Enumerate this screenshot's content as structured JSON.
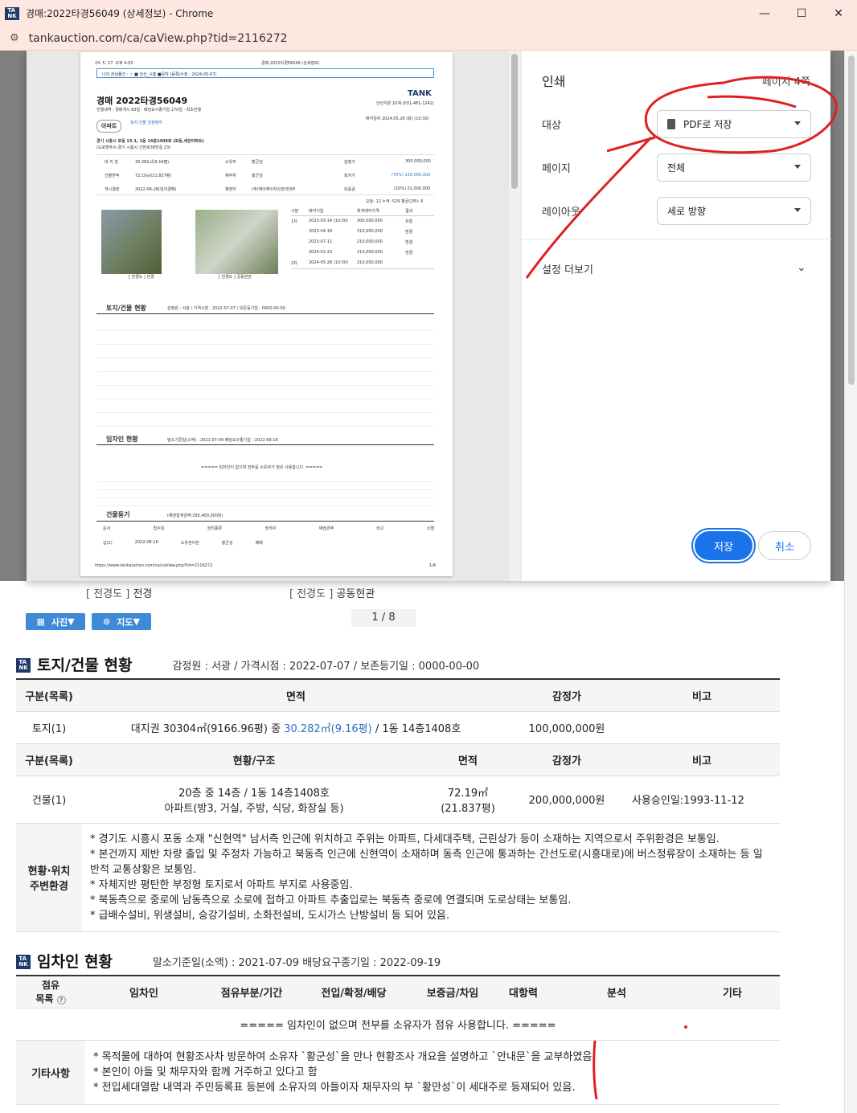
{
  "window": {
    "title": "경매:2022타경56049 (상세정보) - Chrome",
    "url": "tankauction.com/ca/caView.php?tid=2116272",
    "minimize": "—",
    "maximize": "☐",
    "close": "✕"
  },
  "print_dialog": {
    "heading": "인쇄",
    "page_count": "페이지 4쪽",
    "destination_label": "대상",
    "destination_value": "PDF로 저장",
    "pages_label": "페이지",
    "pages_value": "전체",
    "layout_label": "레이아웃",
    "layout_value": "세로 방향",
    "more_settings": "설정 더보기",
    "save": "저장",
    "cancel": "취소"
  },
  "preview": {
    "datetime": "24. 5. 27. 오후 4:03",
    "doc_title": "경매:2022타경56049 (상세정보)",
    "interest_bar": "나의 관심물건 : ☆ ■ 안산_시흥 ■문자 (등록/수정 : 2024-05-07)",
    "tank": "TANK",
    "court": "안산지원 10계 (031-481-1242)",
    "case_no": "경매 2022타경56049",
    "progress": "진행내역 : 경매개시 83일 · 배당요구종기일 170일 · 최초진행",
    "sale_date": "매각일자 2024.05.28 (화) (10:30)",
    "type_badge": "아파트",
    "land_link": "토지·건물 일괄매각",
    "address": "경기 시흥시 포동 13-1, 1동 14층1408호 (포동,세안아파트)",
    "road_address": "(도로명주소:경기 시흥시 신현로38번길 23)",
    "f_area_l": "대 지 권",
    "f_area_v": "30.282㎡(9.16평)",
    "f_owner_l": "소유자",
    "f_owner_v": "황군성",
    "f_appr_l": "감정가",
    "f_appr_v": "300,000,000",
    "f_bld_l": "건물면적",
    "f_bld_v": "72.19㎡(21.837평)",
    "f_debtor_l": "채무자",
    "f_debtor_v": "황군성",
    "f_min_l": "최저가",
    "f_min_v": "(70%) 210,000,000",
    "f_start_l": "개시결정",
    "f_start_v": "2022-06-28(임의경매)",
    "f_cred_l": "채권자",
    "f_cred_v": "(주)케이케이자산관리대부",
    "f_dep_l": "보증금",
    "f_dep_v": "(10%) 21,000,000",
    "views": "오늘: 12 누적: 529 평균(2주): 6",
    "hist_headers": [
      "구분",
      "매각기일",
      "최저매각가격",
      "결과"
    ],
    "hist_rows": [
      [
        "1차",
        "2023-03-14 (10:30)",
        "300,000,000",
        "유찰"
      ],
      [
        "",
        "2023-04-18",
        "210,000,000",
        "변경"
      ],
      [
        "",
        "2023-07-11",
        "210,000,000",
        "변경"
      ],
      [
        "",
        "2024-01-23",
        "210,000,000",
        "변경"
      ],
      [
        "2차",
        "2024-05-28 (10:30)",
        "210,000,000",
        ""
      ]
    ],
    "photo1": "[ 전경도 ] 전경",
    "photo2": "[ 전경도 ] 공동현관",
    "land_title": "토지/건물 현황",
    "land_meta": "감정원 : 서광 / 가격시점 : 2022-07-07 / 보존등기일 : 0000-00-00",
    "tenant_title": "임차인 현황",
    "tenant_meta": "말소기준일(소액) : 2021-07-09 배당요구종기일 : 2022-09-19",
    "tenant_none": "===== 임차인이 없으며 전부를 소유자가 점유 사용합니다. =====",
    "reg_title": "건물등기",
    "reg_meta": "(채권합계금액:295,400,000원)",
    "reg_headers": [
      "순서",
      "접수일",
      "권리종류",
      "권리자",
      "채권금액",
      "비고",
      "소멸"
    ],
    "reg_row": [
      "갑(2)",
      "2022-08-16",
      "소유권이전",
      "황군성",
      "",
      "매매",
      ""
    ],
    "footer_url": "https://www.tankauction.com/ca/caView.php?tid=2116272",
    "footer_page": "1/4"
  },
  "page": {
    "caption1_a": "[ 전경도 ]",
    "caption1_b": "전경",
    "caption2_a": "[ 전경도 ]",
    "caption2_b": "공동현관",
    "photo_btn": "사진",
    "map_btn": "지도",
    "pager": "1 / 8",
    "land": {
      "title": "토지/건물 현황",
      "meta": "감정원 : 서광 / 가격시점 : 2022-07-07 / 보존등기일 : 0000-00-00",
      "h1": [
        "구분(목록)",
        "면적",
        "감정가",
        "비고"
      ],
      "land_label": "토지(1)",
      "land_area_a": "대지권 30304㎡(9166.96평) 중 ",
      "land_area_b": "30.282㎡(9.16평)",
      "land_area_c": " / 1동 14층1408호",
      "land_price": "100,000,000원",
      "h2": [
        "구분(목록)",
        "현황/구조",
        "면적",
        "감정가",
        "비고"
      ],
      "bld_label": "건물(1)",
      "bld_struct_1": "20층 중 14층 / 1동 14층1408호",
      "bld_struct_2": "아파트(방3, 거실, 주방, 식당, 화장실 등)",
      "bld_area_1": "72.19㎡",
      "bld_area_2": "(21.837평)",
      "bld_price": "200,000,000원",
      "bld_note": "사용승인일:1993-11-12",
      "env_label_1": "현황·위치",
      "env_label_2": "주변환경",
      "env": [
        "* 경기도 시흥시 포동 소재 \"신현역\" 남서측 인근에 위치하고 주위는 아파트, 다세대주택, 근린상가 등이 소재하는 지역으로서 주위환경은 보통임.",
        "* 본건까지 제반 차량 출입 및 주정차 가능하고 북동측 인근에 신현역이 소재하며 동측 인근에 통과하는 간선도로(시흥대로)에 버스정류장이 소재하는 등 일반적 교통상황은 보통임.",
        "* 자체지반 평탄한 부정형 토지로서 아파트 부지로 사용중임.",
        "* 북동측으로 중로에 남동측으로 소로에 접하고 아파트 추출입로는 북동측 중로에 연결되며 도로상태는 보통임.",
        "* 급배수설비, 위생설비, 승강기설비, 소화전설비, 도시가스 난방설비 등 되어 있음."
      ]
    },
    "tenant": {
      "title": "임차인 현황",
      "meta": "말소기준일(소액) : 2021-07-09    배당요구종기일 : 2022-09-19",
      "h_occ_1": "점유",
      "h_occ_2": "목록",
      "help": "?",
      "headers": [
        "임차인",
        "점유부분/기간",
        "전입/확정/배당",
        "보증금/차임",
        "대항력",
        "분석",
        "기타"
      ],
      "none": "===== 임차인이 없으며 전부를 소유자가 점유 사용합니다. =====",
      "etc_label": "기타사항",
      "etc": [
        "* 목적물에 대하여 현황조사차 방문하여 소유자 `황군성`을 만나 현황조사 개요을 설명하고 `안내문`을 교부하였음",
        "* 본인이 아들 및 채무자와 함께 거주하고 있다고 함",
        "* 전입세대열람 내역과 주민등록표 등본에 소유자의 아들이자 채무자의 부 `황만성`이 세대주로 등재되어 있음."
      ]
    }
  },
  "colors": {
    "accent": "#1a73e8",
    "brand": "#1e3a6b",
    "link": "#2d6fbf",
    "annotation": "#e02020"
  },
  "icons": [
    "tank-logo-icon",
    "tune-icon",
    "chevron-down-icon",
    "grid-icon",
    "map-pin-icon",
    "file-icon"
  ]
}
